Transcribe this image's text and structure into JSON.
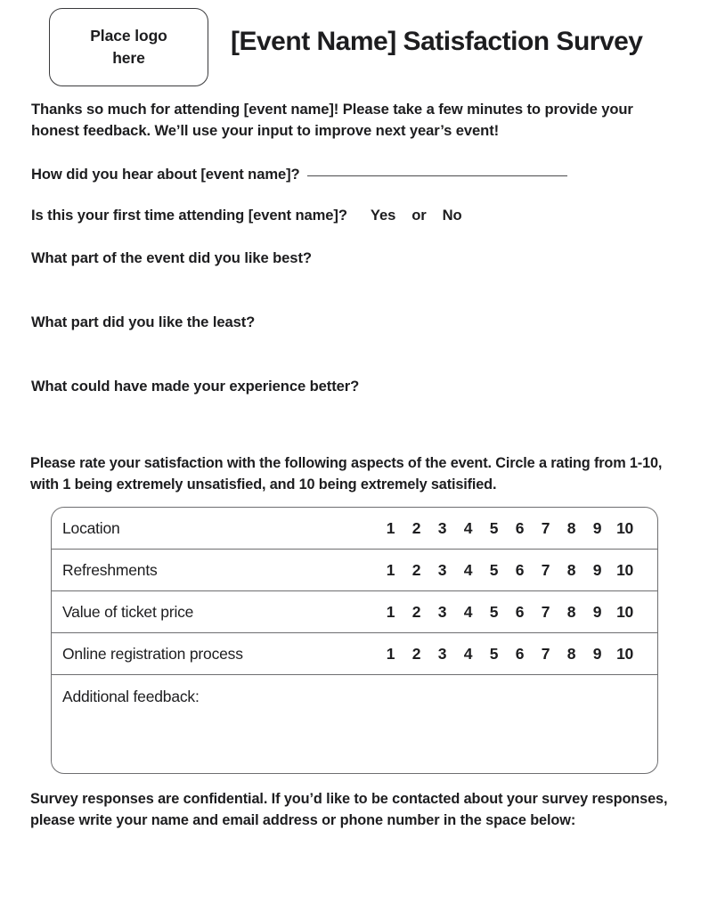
{
  "header": {
    "logo_placeholder": "Place logo\nhere",
    "title": "[Event Name] Satisfaction Survey"
  },
  "intro": {
    "text": "Thanks so much for attending [event name]! Please take a few minutes to provide your honest feedback. We’ll use your input to improve next year’s event!"
  },
  "questions": {
    "how_heard": {
      "label": "How did you hear about [event name]?",
      "answer_value": ""
    },
    "first_time": {
      "label": "Is this your first time attending [event name]?",
      "option_yes": "Yes",
      "conjunction": "or",
      "option_no": "No"
    },
    "liked_best": "What part of the event did you like best?",
    "liked_least": "What part did you like the least?",
    "improvement": "What could have made your experience better?"
  },
  "rating_section": {
    "instructions": "Please rate your satisfaction with the following aspects of the event. Circle a rating from 1-10, with 1 being extremely unsatisfied, and 10 being extremely satisified.",
    "scale": [
      "1",
      "2",
      "3",
      "4",
      "5",
      "6",
      "7",
      "8",
      "9",
      "10"
    ],
    "rows": [
      {
        "label": "Location"
      },
      {
        "label": "Refreshments"
      },
      {
        "label": "Value of ticket price"
      },
      {
        "label": "Online registration process"
      }
    ],
    "additional_feedback": {
      "label": "Additional feedback:",
      "value": ""
    }
  },
  "footer": {
    "confidentiality": "Survey responses are confidential. If you’d like to be contacted about your survey responses, please write your name and email address or phone number in the space below:"
  },
  "colors": {
    "text": "#1d1d1f",
    "border": "#6e6e70",
    "logo_border": "#3a3a3c",
    "background": "#ffffff"
  }
}
